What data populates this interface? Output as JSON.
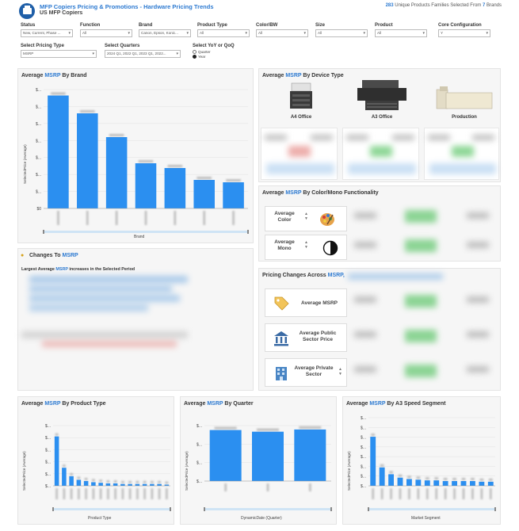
{
  "header": {
    "title": "MFP Copiers Pricing & Promotions - Hardware Pricing Trends",
    "subtitle": "US MFP Copiers",
    "selection_count": "283",
    "selection_mid": "Unique Products Families Selected From",
    "selection_brands": "7",
    "selection_tail": "Brands"
  },
  "filters": {
    "status": {
      "label": "Status",
      "value": "New, Current, Phase ..."
    },
    "function": {
      "label": "Function",
      "value": "All"
    },
    "brand": {
      "label": "Brand",
      "value": "Canon, Epson, Konic..."
    },
    "product_type": {
      "label": "Product Type",
      "value": "All"
    },
    "color_bw": {
      "label": "Color/BW",
      "value": "All"
    },
    "size": {
      "label": "Size",
      "value": "All"
    },
    "product": {
      "label": "Product",
      "value": "All"
    },
    "core_config": {
      "label": "Core Configuration",
      "value": "Y"
    },
    "pricing_type": {
      "label": "Select Pricing Type",
      "value": "MSRP"
    },
    "quarters": {
      "label": "Select Quarters",
      "value": "2024 Q1, 2022 Q1, 2023 Q1, 2022..."
    },
    "yoy_qoq": {
      "label": "Select YoY or QoQ",
      "options": [
        "Quarter",
        "Year"
      ],
      "selected": "Year"
    }
  },
  "brand_panel": {
    "title_prefix": "Average",
    "title_accent": "MSRP",
    "title_suffix": "By Brand",
    "ylabel": "SelectedPrice (Average)",
    "xlabel": "Brand"
  },
  "device_panel": {
    "title_prefix": "Average",
    "title_accent": "MSRP",
    "title_suffix": "By Device Type",
    "devices": [
      "A4 Office",
      "A3 Office",
      "Production"
    ]
  },
  "color_panel": {
    "title_prefix": "Average",
    "title_accent": "MSRP",
    "title_suffix": "By Color/Mono Functionality",
    "cards": [
      {
        "label_line1": "Average",
        "label_line2": "Color"
      },
      {
        "label_line1": "Average",
        "label_line2": "Mono"
      }
    ]
  },
  "changes_panel": {
    "title_prefix": "Changes To",
    "title_accent": "MSRP",
    "sub_prefix": "Largest Average",
    "sub_accent": "MSRP",
    "sub_suffix": "increases in the Selected Period"
  },
  "pricing_changes_panel": {
    "title_prefix": "Pricing Changes Across",
    "title_accent": "MSRP,",
    "cards": [
      {
        "label": "Average MSRP"
      },
      {
        "label": "Average Public Sector Price"
      },
      {
        "label": "Average Private Sector"
      }
    ]
  },
  "product_type_panel": {
    "title_prefix": "Average",
    "title_accent": "MSRP",
    "title_suffix": "By Product Type",
    "ylabel": "SelectedPrice (Average)",
    "xlabel": "Product Type"
  },
  "quarter_panel": {
    "title_prefix": "Average",
    "title_accent": "MSRP",
    "title_suffix": "By Quarter",
    "ylabel": "SelectedPrice (Average)",
    "xlabel": "DynamicDate (Quarter)"
  },
  "speed_panel": {
    "title_prefix": "Average",
    "title_accent": "MSRP",
    "title_suffix": "By A3 Speed Segment",
    "ylabel": "SelectedPrice (Average)",
    "xlabel": "Market Segment"
  },
  "colors": {
    "accent": "#2d7ad1",
    "bar": "#2b8ff0",
    "positive": "#5ec66a",
    "header_icon": "#1f5fa8"
  },
  "chart_data": [
    {
      "type": "bar",
      "title": "Average MSRP By Brand",
      "xlabel": "Brand",
      "ylabel": "SelectedPrice (Average)",
      "ytick_labels": [
        "$0",
        "$...",
        "$...",
        "$...",
        "$...",
        "$...",
        "$...",
        "$..."
      ],
      "series": [
        {
          "values": [
            0.95,
            0.8,
            0.6,
            0.38,
            0.34,
            0.24,
            0.22
          ]
        }
      ]
    },
    {
      "type": "bar",
      "title": "Average MSRP By Product Type",
      "xlabel": "Product Type",
      "ylabel": "SelectedPrice (Average)",
      "ytick_labels": [
        "$...",
        "$...",
        "$...",
        "$...",
        "$...",
        "$..."
      ],
      "series": [
        {
          "values": [
            0.82,
            0.3,
            0.16,
            0.1,
            0.08,
            0.06,
            0.05,
            0.04,
            0.04,
            0.03,
            0.03,
            0.03,
            0.03,
            0.03,
            0.03,
            0.02
          ]
        }
      ]
    },
    {
      "type": "bar",
      "title": "Average MSRP By Quarter",
      "xlabel": "DynamicDate (Quarter)",
      "ylabel": "SelectedPrice (Average)",
      "ytick_labels": [
        "$...",
        "$...",
        "$...",
        "$..."
      ],
      "series": [
        {
          "values": [
            0.92,
            0.89,
            0.93
          ]
        }
      ]
    },
    {
      "type": "bar",
      "title": "Average MSRP By A3 Speed Segment",
      "xlabel": "Market Segment",
      "ylabel": "SelectedPrice (Average)",
      "ytick_labels": [
        "$...",
        "$...",
        "$...",
        "$...",
        "$...",
        "$...",
        "$...",
        "$..."
      ],
      "series": [
        {
          "values": [
            0.72,
            0.27,
            0.17,
            0.12,
            0.1,
            0.09,
            0.08,
            0.08,
            0.07,
            0.07,
            0.07,
            0.07,
            0.06,
            0.06
          ]
        }
      ]
    }
  ]
}
